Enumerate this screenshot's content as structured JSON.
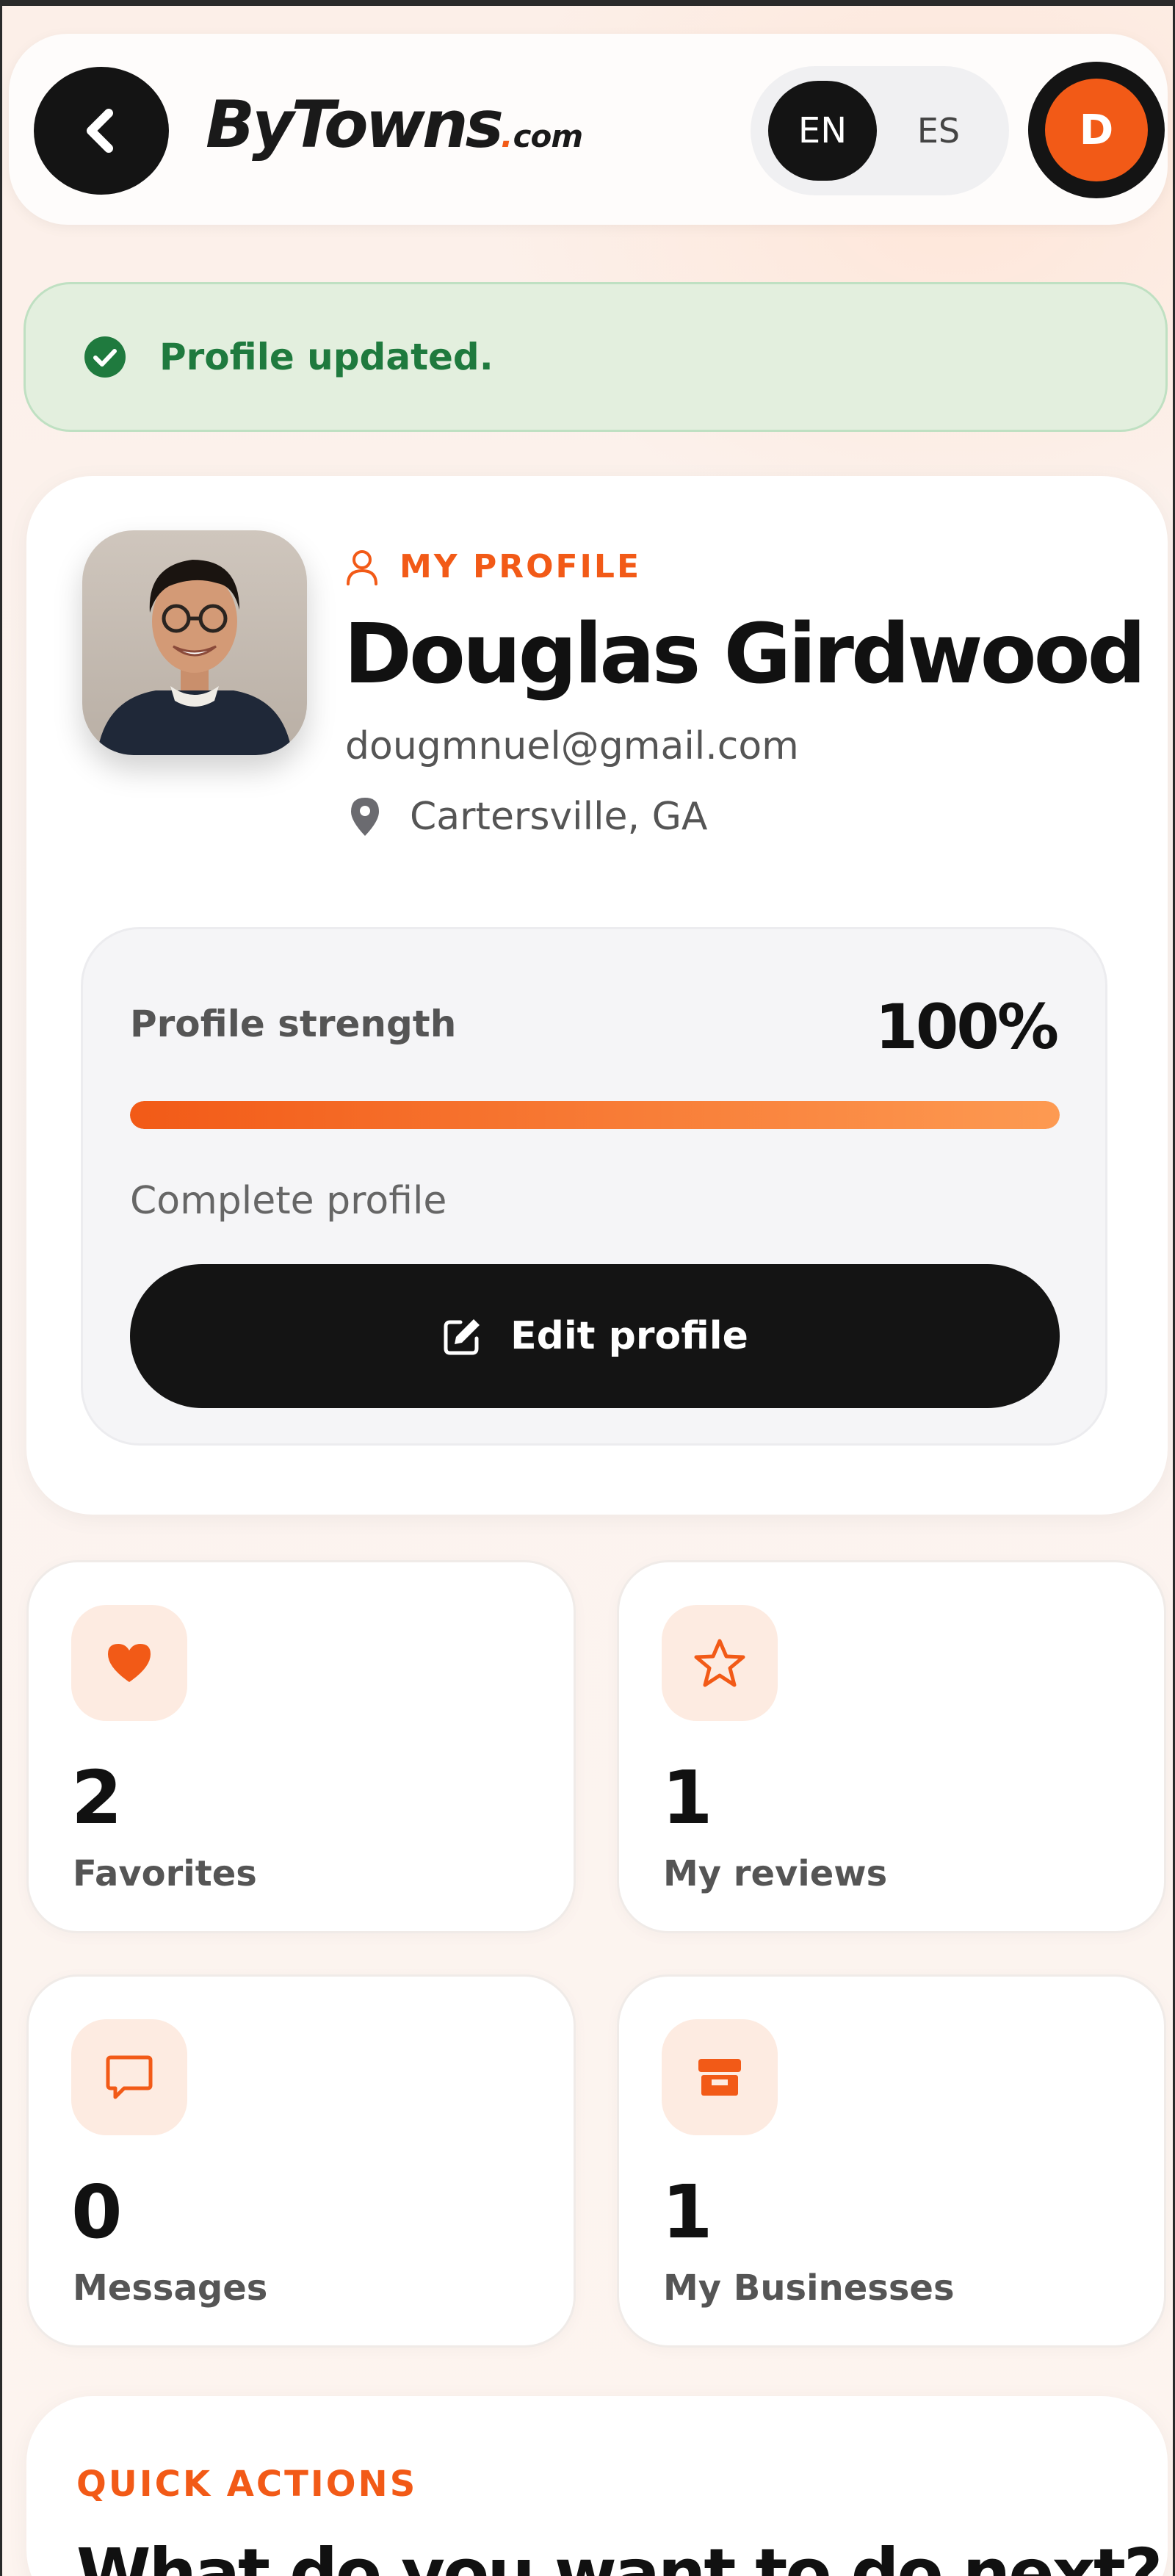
{
  "header": {
    "back_icon": "chevron-left-icon",
    "logo": {
      "main": "ByTowns",
      "dot": ".",
      "suffix": "com"
    },
    "languages": [
      {
        "code": "EN",
        "active": true
      },
      {
        "code": "ES",
        "active": false
      }
    ],
    "user_initial": "D",
    "accent_color": "#f25a17"
  },
  "alert": {
    "icon": "check-circle-icon",
    "message": "Profile updated.",
    "color": "#1f7a3e"
  },
  "profile": {
    "eyebrow": "MY PROFILE",
    "name": "Douglas Girdwood",
    "email": "dougmnuel@gmail.com",
    "location": "Cartersville, GA",
    "strength": {
      "label": "Profile strength",
      "value_text": "100%",
      "progress": 1.0,
      "status": "Complete profile"
    },
    "edit_label": "Edit profile"
  },
  "stats": [
    {
      "icon": "heart-icon",
      "value": "2",
      "label": "Favorites"
    },
    {
      "icon": "star-icon",
      "value": "1",
      "label": "My reviews"
    },
    {
      "icon": "message-icon",
      "value": "0",
      "label": "Messages"
    },
    {
      "icon": "store-icon",
      "value": "1",
      "label": "My Businesses"
    }
  ],
  "quick_actions": {
    "eyebrow": "QUICK ACTIONS",
    "title": "What do you want to do next?"
  }
}
